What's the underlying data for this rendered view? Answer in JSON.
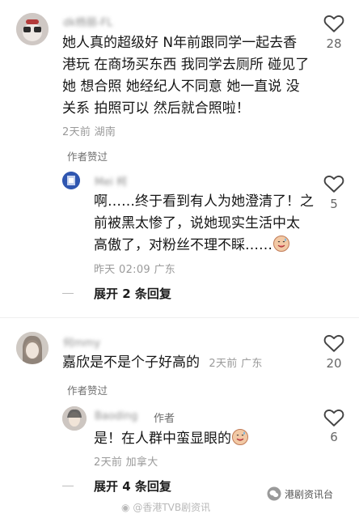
{
  "comments": [
    {
      "username": "dk杨丽-FL",
      "text_lines": [
        "她人真的超级好 N年前跟同学一起去香",
        "港玩 在商场买东西 我同学去厕所 碰见了",
        "她 想合照 她经纪人不同意 她一直说 没",
        "关系 拍照可以 然后就合照啦！"
      ],
      "time": "2天前",
      "location": "湖南",
      "likes": "28",
      "author_liked": "作者赞过",
      "reply": {
        "username": "Mei 柯",
        "text_lines": [
          "啊……终于看到有人为她澄清了！之",
          "前被黑太惨了，说她现实生活中太",
          "高傲了，对粉丝不理不睬……"
        ],
        "time": "昨天 02:09",
        "location": "广东",
        "likes": "5"
      },
      "expand": "展开 2 条回复"
    },
    {
      "username": "何mmy",
      "text_lines": [
        "嘉欣是不是个子好高的"
      ],
      "time": "2天前",
      "location": "广东",
      "likes": "20",
      "author_liked": "作者赞过",
      "reply": {
        "username": "Baoding",
        "author_tag": "作者",
        "text_lines": [
          "是！在人群中蛮显眼的"
        ],
        "time": "2天前",
        "location": "加拿大",
        "likes": "6"
      },
      "expand": "展开 4 条回复"
    }
  ],
  "watermark": {
    "weibo": "@香港TVB剧资讯",
    "wechat": "港剧资讯台"
  }
}
